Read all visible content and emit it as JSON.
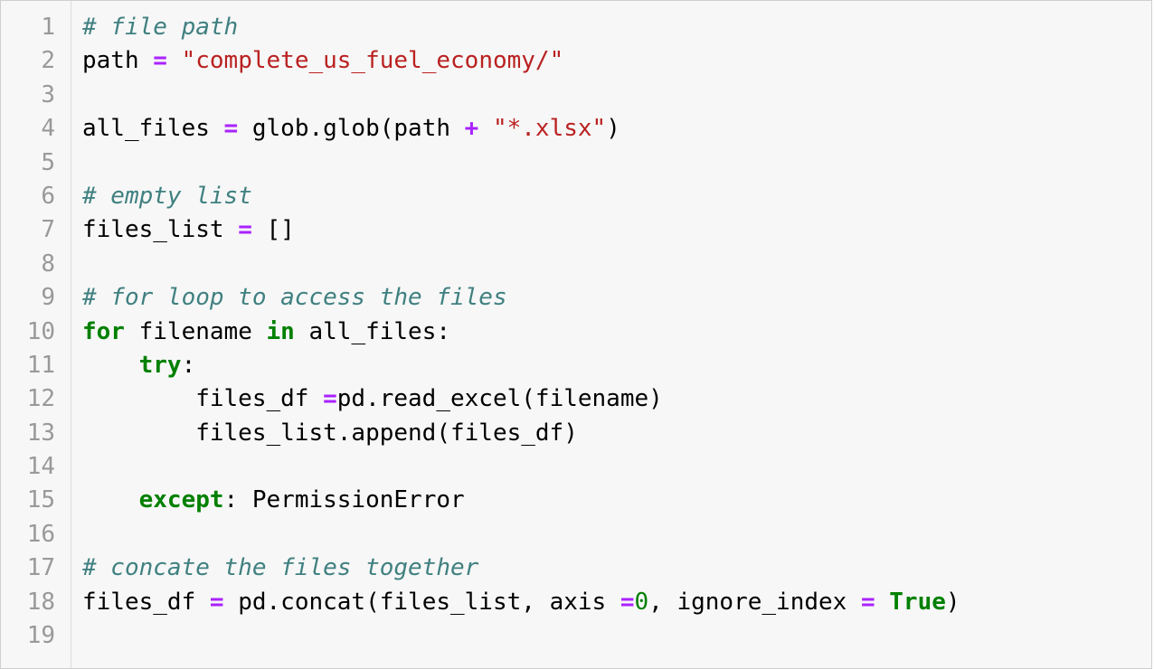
{
  "editor": {
    "line_numbers": [
      "1",
      "2",
      "3",
      "4",
      "5",
      "6",
      "7",
      "8",
      "9",
      "10",
      "11",
      "12",
      "13",
      "14",
      "15",
      "16",
      "17",
      "18",
      "19"
    ],
    "lines": [
      [
        {
          "t": "# file path",
          "k": "cm"
        }
      ],
      [
        {
          "t": "path ",
          "k": ""
        },
        {
          "t": "=",
          "k": "op"
        },
        {
          "t": " ",
          "k": ""
        },
        {
          "t": "\"complete_us_fuel_economy/\"",
          "k": "st"
        }
      ],
      [],
      [
        {
          "t": "all_files ",
          "k": ""
        },
        {
          "t": "=",
          "k": "op"
        },
        {
          "t": " glob.glob(path ",
          "k": ""
        },
        {
          "t": "+",
          "k": "op"
        },
        {
          "t": " ",
          "k": ""
        },
        {
          "t": "\"*.xlsx\"",
          "k": "st"
        },
        {
          "t": ")",
          "k": ""
        }
      ],
      [],
      [
        {
          "t": "# empty list",
          "k": "cm"
        }
      ],
      [
        {
          "t": "files_list ",
          "k": ""
        },
        {
          "t": "=",
          "k": "op"
        },
        {
          "t": " []",
          "k": ""
        }
      ],
      [],
      [
        {
          "t": "# for loop to access the files",
          "k": "cm"
        }
      ],
      [
        {
          "t": "for",
          "k": "kw"
        },
        {
          "t": " filename ",
          "k": ""
        },
        {
          "t": "in",
          "k": "kw"
        },
        {
          "t": " all_files:",
          "k": ""
        }
      ],
      [
        {
          "t": "    ",
          "k": ""
        },
        {
          "t": "try",
          "k": "kw"
        },
        {
          "t": ":",
          "k": ""
        }
      ],
      [
        {
          "t": "        files_df ",
          "k": ""
        },
        {
          "t": "=",
          "k": "op"
        },
        {
          "t": "pd.read_excel(filename)",
          "k": ""
        }
      ],
      [
        {
          "t": "        files_list.append(files_df)",
          "k": ""
        }
      ],
      [],
      [
        {
          "t": "    ",
          "k": ""
        },
        {
          "t": "except",
          "k": "kw"
        },
        {
          "t": ": PermissionError",
          "k": ""
        }
      ],
      [],
      [
        {
          "t": "# concate the files together",
          "k": "cm"
        }
      ],
      [
        {
          "t": "files_df ",
          "k": ""
        },
        {
          "t": "=",
          "k": "op"
        },
        {
          "t": " pd.concat(files_list, axis ",
          "k": ""
        },
        {
          "t": "=",
          "k": "op"
        },
        {
          "t": "0",
          "k": "nm"
        },
        {
          "t": ", ignore_index ",
          "k": ""
        },
        {
          "t": "=",
          "k": "op"
        },
        {
          "t": " ",
          "k": ""
        },
        {
          "t": "True",
          "k": "kw"
        },
        {
          "t": ")",
          "k": ""
        }
      ],
      []
    ]
  },
  "colors": {
    "background": "#f7f7f7",
    "comment": "#408080",
    "operator": "#aa22ff",
    "string": "#ba2121",
    "keyword": "#008000",
    "line_number": "#999999"
  }
}
